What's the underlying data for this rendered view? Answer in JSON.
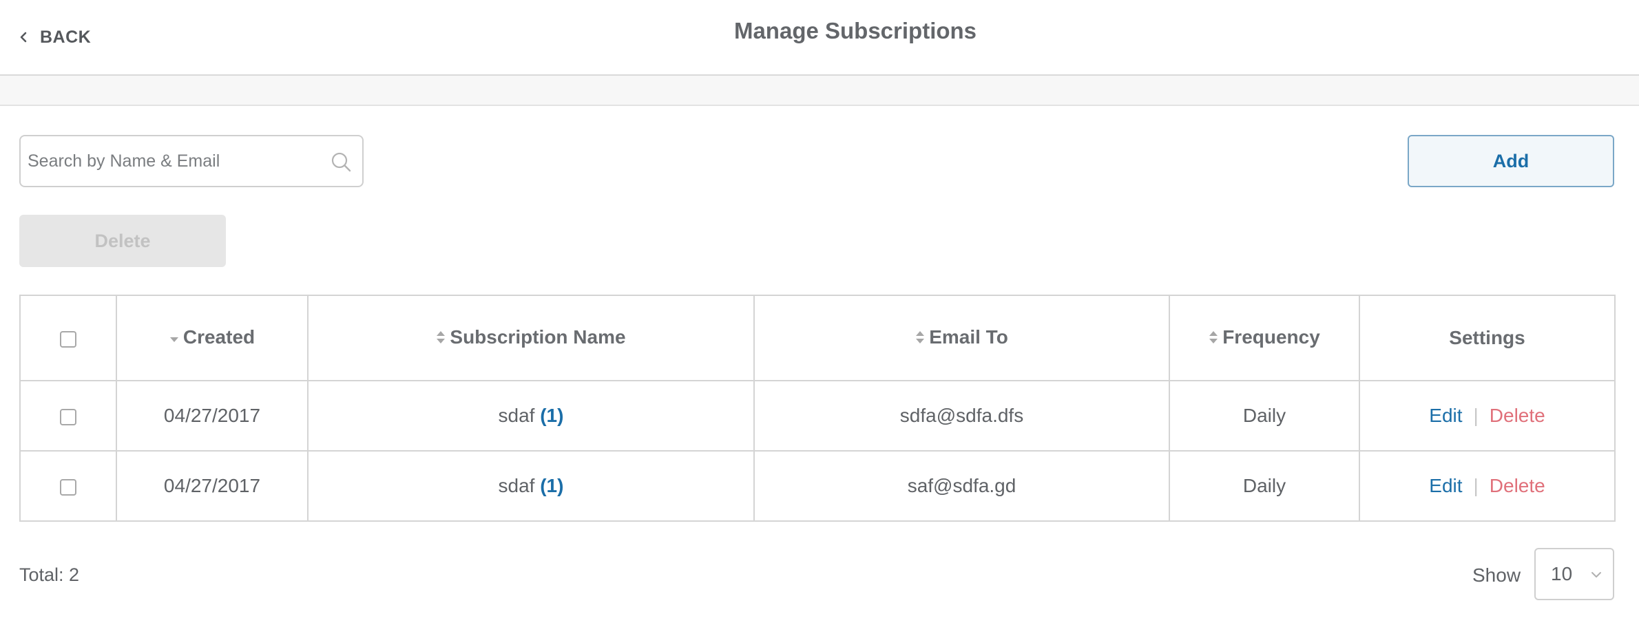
{
  "header": {
    "back_label": "BACK",
    "title": "Manage Subscriptions"
  },
  "search": {
    "placeholder": "Search by Name & Email",
    "value": ""
  },
  "actions": {
    "add_label": "Add",
    "delete_label": "Delete",
    "delete_enabled": false
  },
  "table": {
    "columns": {
      "created": "Created",
      "subscription_name": "Subscription Name",
      "email_to": "Email To",
      "frequency": "Frequency",
      "settings": "Settings"
    },
    "sort": {
      "column": "Created",
      "direction": "descending"
    },
    "rows": [
      {
        "checked": false,
        "created": "04/27/2017",
        "name": "sdaf",
        "count": "(1)",
        "email": "sdfa@sdfa.dfs",
        "frequency": "Daily",
        "edit_label": "Edit",
        "separator": "|",
        "delete_label": "Delete"
      },
      {
        "checked": false,
        "created": "04/27/2017",
        "name": "sdaf",
        "count": "(1)",
        "email": "saf@sdfa.gd",
        "frequency": "Daily",
        "edit_label": "Edit",
        "separator": "|",
        "delete_label": "Delete"
      }
    ]
  },
  "footer": {
    "total_text": "Total: 2",
    "show_label": "Show",
    "page_size": "10"
  },
  "icons": {
    "back": "chevron-left-icon",
    "search": "search-icon",
    "sort": "sort-icon",
    "dropdown": "chevron-down-icon"
  },
  "colors": {
    "accent": "#1b6ea8",
    "danger": "#e0707a",
    "text": "#5f6266",
    "border": "#d4d4d4",
    "disabled_bg": "#e6e6e6"
  }
}
